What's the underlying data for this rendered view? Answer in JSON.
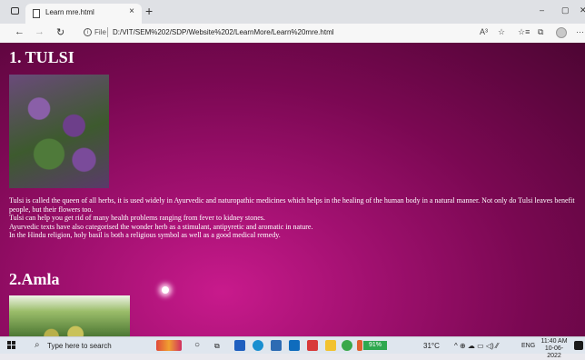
{
  "tab": {
    "title": "Learn mre.html",
    "close": "×",
    "new_tab": "+"
  },
  "window_controls": {
    "minimize": "–",
    "restore": "▢",
    "close": "✕"
  },
  "nav": {
    "back": "←",
    "forward": "→",
    "refresh": "↻",
    "info": "i",
    "file_label": "File",
    "url": "D:/VIT/SEM%202/SDP/Website%202/LearnMore/Learn%20mre.html",
    "read_aloud": "A³",
    "favorites": "☆",
    "more": "···"
  },
  "page": {
    "heading1": "1. TULSI",
    "paragraph1": [
      "Tulsi is called the queen of all herbs, it is used widely in Ayurvedic and naturopathic medicines which helps in the healing of the human body in a natural manner. Not only do Tulsi leaves benefit people, but their flowers too.",
      "Tulsi can help you get rid of many health problems ranging from fever to kidney stones.",
      "Ayurvedic texts have also categorised the wonder herb as a stimulant, antipyretic and aromatic in nature.",
      "In the Hindu religion, holy basil is both a religious symbol as well as a good medical remedy."
    ],
    "heading2": "2.Amla"
  },
  "taskbar": {
    "search_placeholder": "Type here to search",
    "battery": "91%",
    "temperature": "31°C",
    "language": "ENG",
    "time": "11:40 AM",
    "date": "10-06-2022"
  },
  "colors": {
    "page_bg": "#7a0852",
    "page_accent": "#c81a8c",
    "text": "#ffffff"
  }
}
